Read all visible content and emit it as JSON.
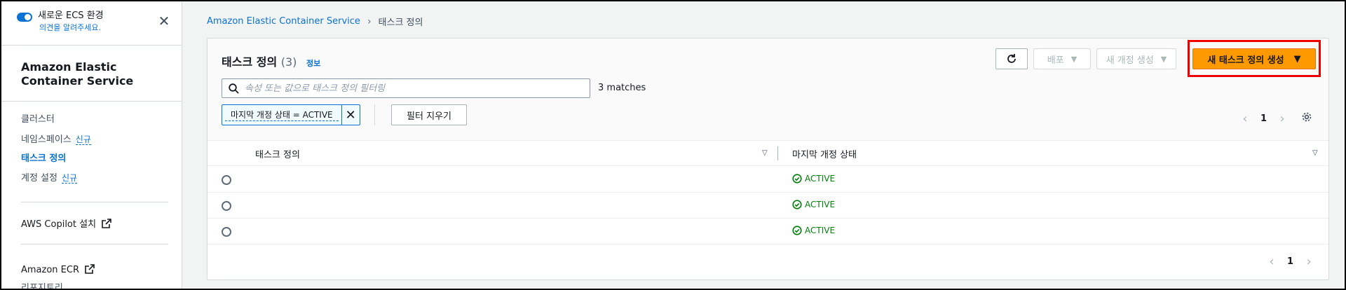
{
  "sidebar": {
    "toggle_title": "새로운 ECS 환경",
    "toggle_sub": "의견을 알려주세요.",
    "service_title": "Amazon Elastic Container Service",
    "nav": [
      {
        "label": "클러스터"
      },
      {
        "label": "네임스페이스",
        "badge": "신규"
      },
      {
        "label": "태스크 정의",
        "active": true
      },
      {
        "label": "계정 설정",
        "badge": "신규"
      }
    ],
    "copilot": "AWS Copilot 설치",
    "ecr": "Amazon ECR",
    "repo": "리포지토리"
  },
  "breadcrumb": {
    "root": "Amazon Elastic Container Service",
    "current": "태스크 정의"
  },
  "panel": {
    "title": "태스크 정의",
    "count": "(3)",
    "info": "정보",
    "deploy_label": "배포",
    "new_revision_label": "새 개정 생성",
    "create_label": "새 태스크 정의 생성",
    "search_placeholder": "속성 또는 값으로 태스크 정의 필터링",
    "matches": "3 matches",
    "filter_chip": "마지막 개정 상태 = ACTIVE",
    "clear_filter": "필터 지우기",
    "page": "1"
  },
  "table": {
    "columns": [
      "태스크 정의",
      "마지막 개정 상태"
    ],
    "rows": [
      {
        "name": "",
        "status": "ACTIVE"
      },
      {
        "name": "",
        "status": "ACTIVE"
      },
      {
        "name": "",
        "status": "ACTIVE"
      }
    ]
  },
  "colors": {
    "link": "#0972d3",
    "primary": "#ff9900",
    "success": "#037f0c",
    "highlight": "#ee0000"
  }
}
